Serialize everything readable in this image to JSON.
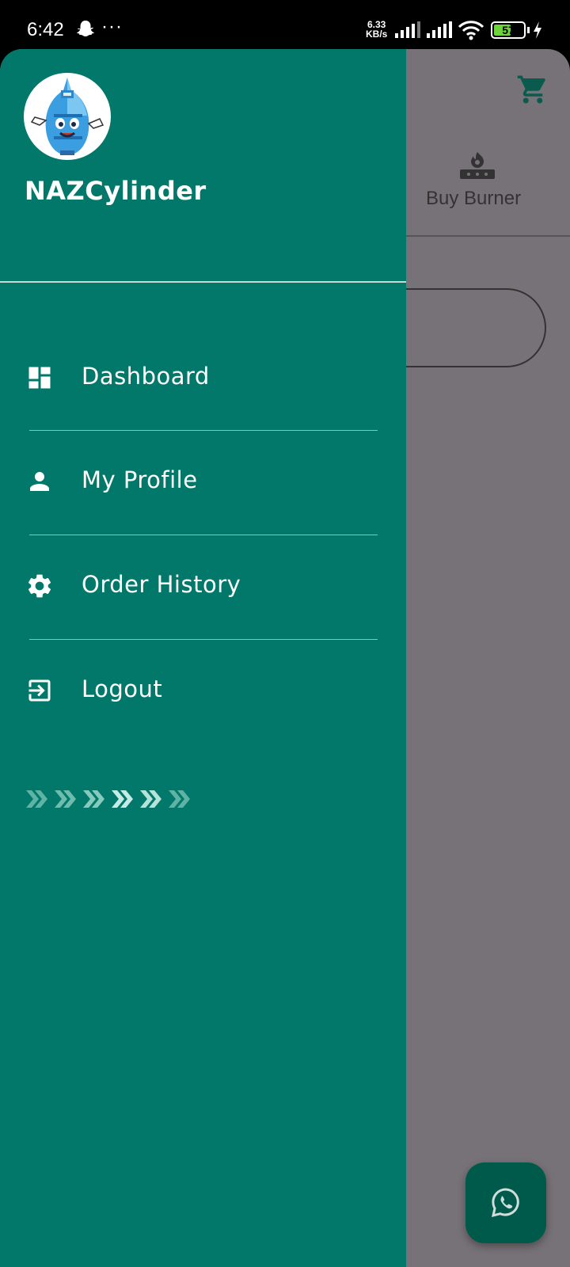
{
  "status_bar": {
    "time": "6:42",
    "dots": "···",
    "net_speed_value": "6.33",
    "net_speed_unit": "KB/s",
    "battery_percent": "57",
    "battery_level": 0.57,
    "icons": [
      "snapchat-icon",
      "signal-icon",
      "wifi-icon",
      "battery-icon",
      "charging-icon"
    ]
  },
  "background_screen": {
    "cart_icon": "cart-icon",
    "tab_label": "Buy Burner",
    "tab_icon": "burner-icon",
    "fab_icon": "whatsapp-icon"
  },
  "drawer": {
    "app_name": "NAZCylinder",
    "logo_icon": "cylinder-mascot-logo",
    "items": [
      {
        "label": "Dashboard",
        "icon": "dashboard-icon"
      },
      {
        "label": "My Profile",
        "icon": "person-icon"
      },
      {
        "label": "Order History",
        "icon": "gear-icon"
      },
      {
        "label": "Logout",
        "icon": "logout-icon"
      }
    ],
    "decor_icon": "chevrons-icon"
  },
  "colors": {
    "drawer_bg": "#02786a",
    "scrim": "#777277",
    "fab_bg": "#005a4c",
    "cart_icon": "#0a5a4e"
  }
}
